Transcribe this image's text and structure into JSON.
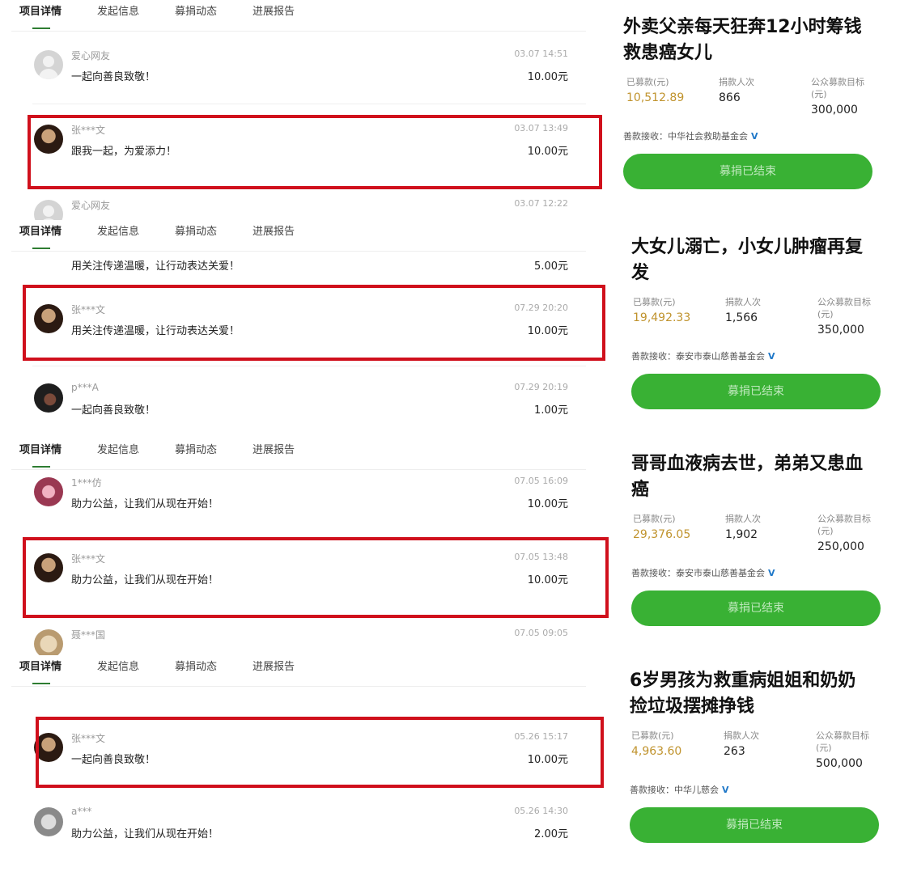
{
  "tabs": [
    "项目详情",
    "发起信息",
    "募捐动态",
    "进展报告"
  ],
  "panels": [
    {
      "rows": [
        {
          "name": "爱心网友",
          "time": "03.07 14:51",
          "msg": "一起向善良致敬！",
          "amount": "10.00元"
        },
        {
          "name": "张***文",
          "time": "03.07 13:49",
          "msg": "跟我一起，为爱添力！",
          "amount": "10.00元"
        },
        {
          "name": "爱心网友",
          "time": "03.07 12:22",
          "msg": "",
          "amount": ""
        }
      ]
    },
    {
      "rows": [
        {
          "name": "",
          "time": "",
          "msg": "用关注传递温暖，让行动表达关爱！",
          "amount": "5.00元"
        },
        {
          "name": "张***文",
          "time": "07.29 20:20",
          "msg": "用关注传递温暖，让行动表达关爱！",
          "amount": "10.00元"
        },
        {
          "name": "p***A",
          "time": "07.29 20:19",
          "msg": "一起向善良致敬！",
          "amount": "1.00元"
        }
      ]
    },
    {
      "rows": [
        {
          "name": "1***仿",
          "time": "07.05 16:09",
          "msg": "助力公益，让我们从现在开始！",
          "amount": "10.00元"
        },
        {
          "name": "张***文",
          "time": "07.05 13:48",
          "msg": "助力公益，让我们从现在开始！",
          "amount": "10.00元"
        },
        {
          "name": "聂***国",
          "time": "07.05 09:05",
          "msg": "",
          "amount": ""
        }
      ]
    },
    {
      "rows": [
        {
          "name": "张***文",
          "time": "05.26 15:17",
          "msg": "一起向善良致敬！",
          "amount": "10.00元"
        },
        {
          "name": "a***",
          "time": "05.26 14:30",
          "msg": "助力公益，让我们从现在开始！",
          "amount": "2.00元"
        }
      ]
    }
  ],
  "cards": [
    {
      "title": "外卖父亲每天狂奔12小时筹钱救患癌女儿",
      "raised_label": "已募款(元)",
      "raised": "10,512.89",
      "donors_label": "捐款人次",
      "donors": "866",
      "target_label": "公众募款目标(元)",
      "target": "300,000",
      "org_label": "善款接收：",
      "org": "中华社会救助基金会",
      "button": "募捐已结束"
    },
    {
      "title": "大女儿溺亡，小女儿肿瘤再复发",
      "raised_label": "已募款(元)",
      "raised": "19,492.33",
      "donors_label": "捐款人次",
      "donors": "1,566",
      "target_label": "公众募款目标(元)",
      "target": "350,000",
      "org_label": "善款接收：",
      "org": "泰安市泰山慈善基金会",
      "button": "募捐已结束"
    },
    {
      "title": "哥哥血液病去世，弟弟又患血癌",
      "raised_label": "已募款(元)",
      "raised": "29,376.05",
      "donors_label": "捐款人次",
      "donors": "1,902",
      "target_label": "公众募款目标(元)",
      "target": "250,000",
      "org_label": "善款接收：",
      "org": "泰安市泰山慈善基金会",
      "button": "募捐已结束"
    },
    {
      "title": "6岁男孩为救重病姐姐和奶奶捡垃圾摆摊挣钱",
      "raised_label": "已募款(元)",
      "raised": "4,963.60",
      "donors_label": "捐款人次",
      "donors": "263",
      "target_label": "公众募款目标(元)",
      "target": "500,000",
      "org_label": "善款接收：",
      "org": "中华儿慈会",
      "button": "募捐已结束"
    }
  ]
}
